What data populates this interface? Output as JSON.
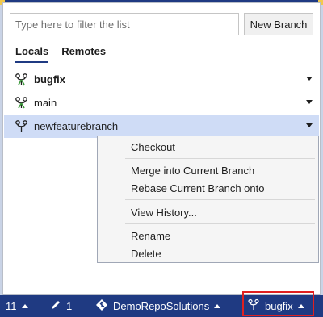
{
  "filter": {
    "placeholder": "Type here to filter the list"
  },
  "new_branch_label": "New Branch",
  "tabs": [
    {
      "label": "Locals",
      "active": true
    },
    {
      "label": "Remotes",
      "active": false
    }
  ],
  "branches": [
    {
      "name": "bugfix",
      "bold": true,
      "icon": "branch-current-icon"
    },
    {
      "name": "main",
      "bold": false,
      "icon": "branch-current-icon"
    },
    {
      "name": "newfeaturebranch",
      "bold": false,
      "icon": "branch-icon",
      "selected": true
    }
  ],
  "context_menu": {
    "items": [
      "Checkout",
      "Merge into Current Branch",
      "Rebase Current Branch onto",
      "View History...",
      "Rename",
      "Delete"
    ]
  },
  "statusbar": {
    "up_count": "11",
    "pending_edits": "1",
    "repo_name": "DemoRepoSolutions",
    "current_branch": "bugfix"
  },
  "colors": {
    "statusbar_bg": "#1f3a82",
    "selection_bg": "#cfdcf6",
    "highlight_box": "#e02020",
    "branch_icon_green": "#3a9a3a"
  }
}
